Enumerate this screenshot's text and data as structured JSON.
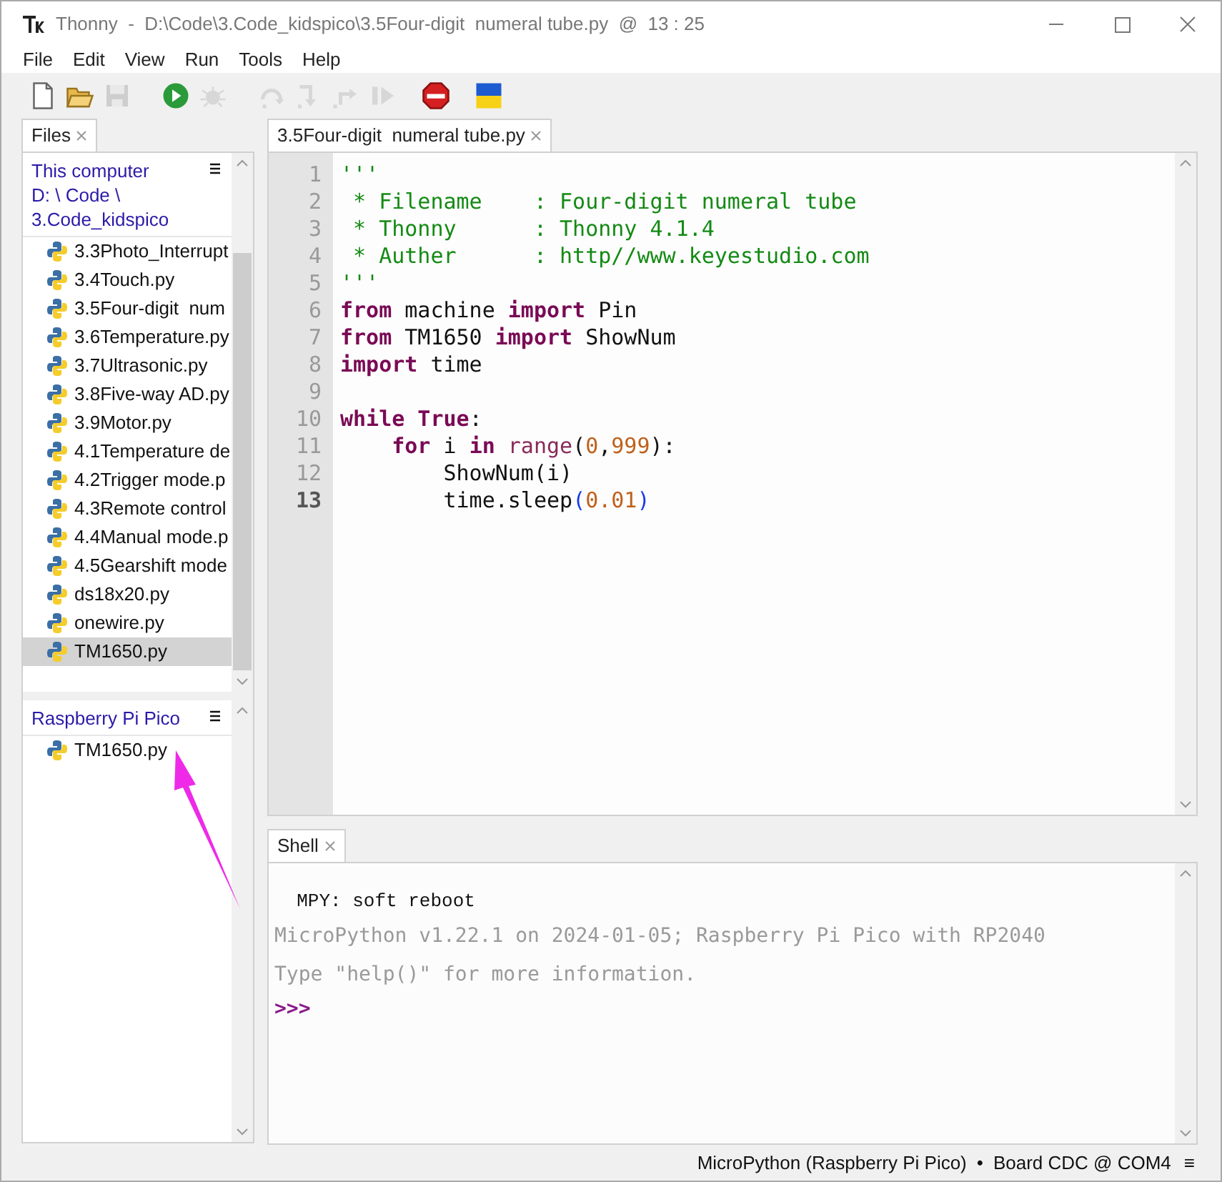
{
  "window": {
    "title": "Thonny  -  D:\\Code\\3.Code_kidspico\\3.5Four-digit  numeral tube.py  @  13 : 25"
  },
  "menu": [
    "File",
    "Edit",
    "View",
    "Run",
    "Tools",
    "Help"
  ],
  "toolbar": [
    {
      "kind": "new",
      "disabled": false
    },
    {
      "kind": "open",
      "disabled": false
    },
    {
      "kind": "save",
      "disabled": true
    },
    {
      "kind": "run",
      "disabled": false
    },
    {
      "kind": "debug",
      "disabled": true
    },
    {
      "kind": "step_over",
      "disabled": true
    },
    {
      "kind": "step_into",
      "disabled": true
    },
    {
      "kind": "step_out",
      "disabled": true
    },
    {
      "kind": "resume",
      "disabled": true
    },
    {
      "kind": "stop",
      "disabled": false
    },
    {
      "kind": "flag",
      "disabled": false
    }
  ],
  "files_panel": {
    "tab": "Files",
    "computer": {
      "heading": [
        "This computer",
        "D: \\ Code \\",
        "3.Code_kidspico"
      ],
      "items": [
        {
          "name": "3.3Photo_Interrupt",
          "selected": false
        },
        {
          "name": "3.4Touch.py",
          "selected": false
        },
        {
          "name": "3.5Four-digit  num",
          "selected": false
        },
        {
          "name": "3.6Temperature.py",
          "selected": false
        },
        {
          "name": "3.7Ultrasonic.py",
          "selected": false
        },
        {
          "name": "3.8Five-way AD.py",
          "selected": false
        },
        {
          "name": "3.9Motor.py",
          "selected": false
        },
        {
          "name": "4.1Temperature de",
          "selected": false
        },
        {
          "name": "4.2Trigger mode.p",
          "selected": false
        },
        {
          "name": "4.3Remote control",
          "selected": false
        },
        {
          "name": "4.4Manual mode.p",
          "selected": false
        },
        {
          "name": "4.5Gearshift mode",
          "selected": false
        },
        {
          "name": "ds18x20.py",
          "selected": false
        },
        {
          "name": "onewire.py",
          "selected": false
        },
        {
          "name": "TM1650.py",
          "selected": true
        }
      ]
    },
    "device": {
      "heading": "Raspberry Pi Pico",
      "items": [
        {
          "name": "TM1650.py",
          "selected": false
        }
      ]
    }
  },
  "editor": {
    "tab": "3.5Four-digit  numeral tube.py",
    "lines": [
      {
        "number": "1",
        "current": false,
        "tokens": [
          {
            "kind": "string",
            "text": "'''"
          }
        ]
      },
      {
        "number": "2",
        "current": false,
        "tokens": [
          {
            "kind": "string",
            "text": " * Filename    : Four-digit numeral tube"
          }
        ]
      },
      {
        "number": "3",
        "current": false,
        "tokens": [
          {
            "kind": "string",
            "text": " * Thonny      : Thonny 4.1.4"
          }
        ]
      },
      {
        "number": "4",
        "current": false,
        "tokens": [
          {
            "kind": "string",
            "text": " * Auther      : http//www.keyestudio.com"
          }
        ]
      },
      {
        "number": "5",
        "current": false,
        "tokens": [
          {
            "kind": "string",
            "text": "'''"
          }
        ]
      },
      {
        "number": "6",
        "current": false,
        "tokens": [
          {
            "kind": "keyword",
            "text": "from"
          },
          {
            "kind": "plain",
            "text": " machine "
          },
          {
            "kind": "keyword",
            "text": "import"
          },
          {
            "kind": "plain",
            "text": " Pin"
          }
        ]
      },
      {
        "number": "7",
        "current": false,
        "tokens": [
          {
            "kind": "keyword",
            "text": "from"
          },
          {
            "kind": "plain",
            "text": " TM1650 "
          },
          {
            "kind": "keyword",
            "text": "import"
          },
          {
            "kind": "plain",
            "text": " ShowNum"
          }
        ]
      },
      {
        "number": "8",
        "current": false,
        "tokens": [
          {
            "kind": "keyword",
            "text": "import"
          },
          {
            "kind": "plain",
            "text": " time"
          }
        ]
      },
      {
        "number": "9",
        "current": false
      },
      {
        "number": "10",
        "current": false,
        "tokens": [
          {
            "kind": "keyword",
            "text": "while True"
          },
          {
            "kind": "plain",
            "text": ":"
          }
        ]
      },
      {
        "number": "11",
        "current": false,
        "tokens": [
          {
            "kind": "keyword",
            "text": "    for"
          },
          {
            "kind": "plain",
            "text": " i "
          },
          {
            "kind": "keyword",
            "text": "in"
          },
          {
            "kind": "builtin",
            "text": " range"
          },
          {
            "kind": "plain",
            "text": "("
          },
          {
            "kind": "number",
            "text": "0"
          },
          {
            "kind": "plain",
            "text": ","
          },
          {
            "kind": "number",
            "text": "999"
          },
          {
            "kind": "plain",
            "text": "):"
          }
        ]
      },
      {
        "number": "12",
        "current": false,
        "tokens": [
          {
            "kind": "plain",
            "text": "        ShowNum(i)"
          }
        ]
      },
      {
        "number": "13",
        "current": true,
        "tokens": [
          {
            "kind": "plain",
            "text": "        time.sleep"
          },
          {
            "kind": "bracket",
            "text": "("
          },
          {
            "kind": "number",
            "text": "0.01"
          },
          {
            "kind": "bracket",
            "text": ")"
          }
        ]
      }
    ]
  },
  "shell": {
    "tab": "Shell",
    "lines": [
      {
        "kind": "output",
        "text": "  MPY: soft reboot"
      },
      {
        "kind": "banner",
        "text": "MicroPython v1.22.1 on 2024-01-05; Raspberry Pi Pico with RP2040"
      },
      {
        "kind": "banner",
        "text": "Type \"help()\" for more information."
      },
      {
        "kind": "prompt",
        "text": ">>>"
      }
    ]
  },
  "status_bar": {
    "interpreter": "MicroPython (Raspberry Pi Pico)",
    "separator": "•",
    "port": "Board CDC @ COM4",
    "menu": "≡"
  }
}
